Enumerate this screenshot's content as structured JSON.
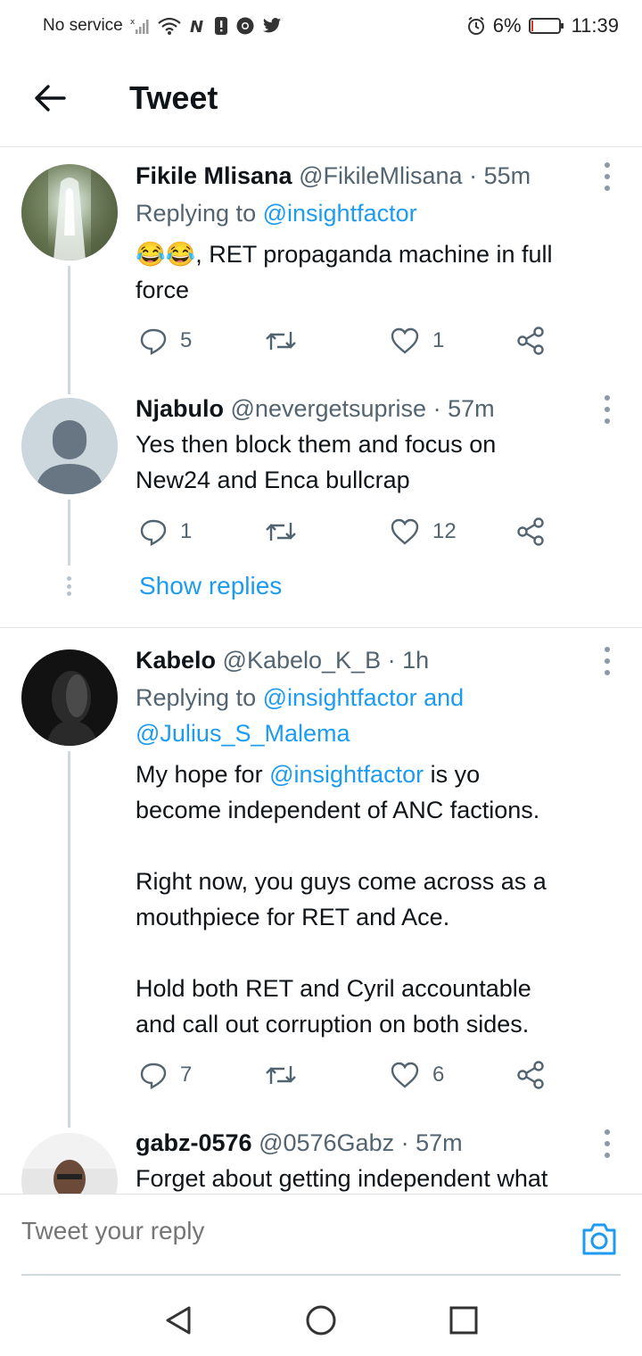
{
  "status_bar": {
    "carrier": "No service",
    "battery_percent": "6%",
    "time": "11:39",
    "battery_level": 0.06
  },
  "header": {
    "title": "Tweet"
  },
  "tweets": [
    {
      "name": "Fikile Mlisana",
      "handle": "@FikileMlisana",
      "separator": "·",
      "time": "55m",
      "replying_prefix": "Replying to",
      "replying_to": "@insightfactor",
      "emoji": "😂😂",
      "text_line1": ", RET propaganda machine in full",
      "text_line2": "force",
      "replies": "5",
      "retweets": "",
      "likes": "1"
    },
    {
      "name": "Njabulo",
      "handle": "@nevergetsuprise",
      "separator": "·",
      "time": "57m",
      "text_line1": "Yes then block them and focus on",
      "text_line2": "New24 and Enca bullcrap",
      "replies": "1",
      "retweets": "",
      "likes": "12",
      "show_replies": "Show replies"
    },
    {
      "name": "Kabelo",
      "handle": "@Kabelo_K_B",
      "separator": "·",
      "time": "1h",
      "replying_prefix": "Replying to",
      "replying_to": "@insightfactor and",
      "replying_to_2": "@Julius_S_Malema",
      "p1_prefix": "My hope for",
      "p1_mention": "@insightfactor",
      "p1_suffix": "is yo",
      "p1_line2": "become independent of ANC factions.",
      "p2_line1": "Right now, you guys come across as a",
      "p2_line2": "mouthpiece for RET and Ace.",
      "p3_line1": "Hold both RET and Cyril accountable",
      "p3_line2": "and call out corruption on both sides.",
      "replies": "7",
      "retweets": "",
      "likes": "6"
    },
    {
      "name": "gabz-0576",
      "handle": "@0576Gabz",
      "separator": "·",
      "time": "57m",
      "text_line1": "Forget about getting independent what"
    }
  ],
  "compose": {
    "placeholder": "Tweet your reply"
  },
  "icons": {
    "back": "arrow-left-icon",
    "reply": "reply-icon",
    "retweet": "retweet-icon",
    "like": "heart-icon",
    "share": "share-icon",
    "camera": "camera-icon"
  }
}
